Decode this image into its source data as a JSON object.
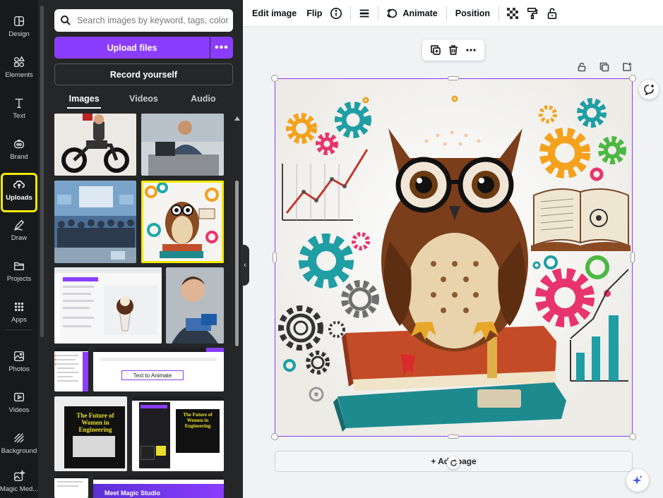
{
  "rail": {
    "items": [
      {
        "label": "Design",
        "icon": "design-icon"
      },
      {
        "label": "Elements",
        "icon": "elements-icon"
      },
      {
        "label": "Text",
        "icon": "text-icon"
      },
      {
        "label": "Brand",
        "icon": "brand-icon"
      },
      {
        "label": "Uploads",
        "icon": "upload-cloud-icon",
        "active": true
      },
      {
        "label": "Draw",
        "icon": "draw-icon"
      },
      {
        "label": "Projects",
        "icon": "folder-icon"
      },
      {
        "label": "Apps",
        "icon": "apps-icon"
      },
      {
        "label": "Photos",
        "icon": "photos-icon"
      },
      {
        "label": "Videos",
        "icon": "videos-icon"
      },
      {
        "label": "Background",
        "icon": "background-icon"
      },
      {
        "label": "Magic Med...",
        "icon": "magic-media-icon"
      }
    ],
    "highlight_color": "#f4ea00"
  },
  "panel": {
    "search_placeholder": "Search images by keyword, tags, color...",
    "upload_label": "Upload files",
    "upload_more": "•••",
    "record_label": "Record yourself",
    "tabs": [
      {
        "label": "Images",
        "active": true
      },
      {
        "label": "Videos"
      },
      {
        "label": "Audio"
      }
    ],
    "thumb_texts": {
      "women_title": "The Future of Women in Engineering",
      "text_to_animate": "Text to Animate",
      "meet_magic": "Meet Magic Studio"
    }
  },
  "toolbar": {
    "edit_image": "Edit image",
    "flip": "Flip",
    "animate": "Animate",
    "position": "Position"
  },
  "canvas": {
    "add_page": "+ Add page",
    "accent": "#8b3dff"
  }
}
